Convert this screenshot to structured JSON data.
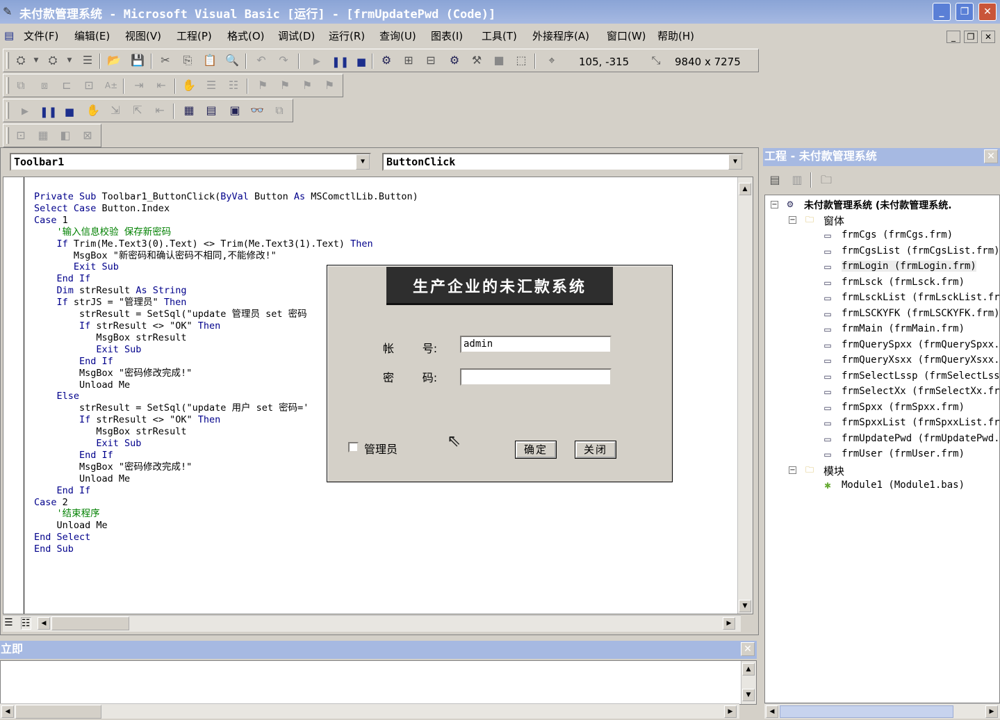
{
  "window": {
    "title": "未付款管理系统 - Microsoft Visual Basic [运行] - [frmUpdatePwd (Code)]",
    "min_label": "_",
    "restore_label": "❐",
    "close_label": "✕"
  },
  "menu": [
    "文件(F)",
    "编辑(E)",
    "视图(V)",
    "工程(P)",
    "格式(O)",
    "调试(D)",
    "运行(R)",
    "查询(U)",
    "图表(I)",
    "工具(T)",
    "外接程序(A)",
    "窗口(W)",
    "帮助(H)"
  ],
  "toolbar": {
    "position_readout": "105, -315",
    "size_readout": "9840 x 7275"
  },
  "code_window": {
    "object_combo": "Toolbar1",
    "procedure_combo": "ButtonClick"
  },
  "code_lines": [
    [
      {
        "t": "Private Sub ",
        "k": 1
      },
      {
        "t": "Toolbar1_ButtonClick("
      },
      {
        "t": "ByVal",
        "k": 1
      },
      {
        "t": " Button "
      },
      {
        "t": "As",
        "k": 1
      },
      {
        "t": " MSComctlLib.Button)"
      }
    ],
    [
      {
        "t": "Select Case",
        "k": 1
      },
      {
        "t": " Button.Index"
      }
    ],
    [
      {
        "t": "Case",
        "k": 1
      },
      {
        "t": " 1"
      }
    ],
    [
      {
        "t": "    '输入信息校验 保存新密码",
        "c": 1
      }
    ],
    [
      {
        "t": "    If",
        "k": 1
      },
      {
        "t": " Trim(Me.Text3(0).Text) <> Trim(Me.Text3(1).Text) "
      },
      {
        "t": "Then",
        "k": 1
      }
    ],
    [
      {
        "t": "       MsgBox \"新密码和确认密码不相同,不能修改!\""
      }
    ],
    [
      {
        "t": "       Exit Sub",
        "k": 1
      }
    ],
    [
      {
        "t": "    End If",
        "k": 1
      }
    ],
    [
      {
        "t": "    Dim",
        "k": 1
      },
      {
        "t": " strResult "
      },
      {
        "t": "As String",
        "k": 1
      }
    ],
    [
      {
        "t": "    If",
        "k": 1
      },
      {
        "t": " strJS = \"管理员\" "
      },
      {
        "t": "Then",
        "k": 1
      }
    ],
    [
      {
        "t": "        strResult = SetSql(\"update 管理员 set 密码"
      }
    ],
    [
      {
        "t": "        If",
        "k": 1
      },
      {
        "t": " strResult <> \"OK\" "
      },
      {
        "t": "Then",
        "k": 1
      }
    ],
    [
      {
        "t": "           MsgBox strResult"
      }
    ],
    [
      {
        "t": "           Exit Sub",
        "k": 1
      }
    ],
    [
      {
        "t": "        End If",
        "k": 1
      }
    ],
    [
      {
        "t": "        MsgBox \"密码修改完成!\""
      }
    ],
    [
      {
        "t": "        Unload Me"
      }
    ],
    [
      {
        "t": "    Else",
        "k": 1
      }
    ],
    [
      {
        "t": "        strResult = SetSql(\"update 用户 set 密码='"
      }
    ],
    [
      {
        "t": "        If",
        "k": 1
      },
      {
        "t": " strResult <> \"OK\" "
      },
      {
        "t": "Then",
        "k": 1
      }
    ],
    [
      {
        "t": "           MsgBox strResult"
      }
    ],
    [
      {
        "t": "           Exit Sub",
        "k": 1
      }
    ],
    [
      {
        "t": "        End If",
        "k": 1
      }
    ],
    [
      {
        "t": "        MsgBox \"密码修改完成!\""
      }
    ],
    [
      {
        "t": "        Unload Me"
      }
    ],
    [
      {
        "t": "    End If",
        "k": 1
      }
    ],
    [
      {
        "t": "Case",
        "k": 1
      },
      {
        "t": " 2"
      }
    ],
    [
      {
        "t": "    '结束程序",
        "c": 1
      }
    ],
    [
      {
        "t": "    Unload Me"
      }
    ],
    [
      {
        "t": "End Select",
        "k": 1
      }
    ],
    [
      {
        "t": "End Sub",
        "k": 1
      }
    ]
  ],
  "login_dialog": {
    "header": "生产企业的未汇款系统",
    "account_label": "帐        号:",
    "account_value": "admin",
    "password_label": "密        码:",
    "password_value": "",
    "admin_checkbox_label": "管理员",
    "admin_checked": false,
    "ok_button": "确定",
    "close_button": "关闭"
  },
  "project_explorer": {
    "title": "工程 - 未付款管理系统",
    "root": "未付款管理系统 (未付款管理系统.",
    "forms_folder": "窗体",
    "forms": [
      "frmCgs (frmCgs.frm)",
      "frmCgsList (frmCgsList.frm)",
      "frmLogin (frmLogin.frm)",
      "frmLsck (frmLsck.frm)",
      "frmLsckList (frmLsckList.fr",
      "frmLSCKYFK (frmLSCKYFK.frm)",
      "frmMain (frmMain.frm)",
      "frmQuerySpxx (frmQuerySpxx.",
      "frmQueryXsxx (frmQueryXsxx.",
      "frmSelectLssp (frmSelectLss",
      "frmSelectXx (frmSelectXx.fr",
      "frmSpxx (frmSpxx.frm)",
      "frmSpxxList (frmSpxxList.fr",
      "frmUpdatePwd (frmUpdatePwd.",
      "frmUser (frmUser.frm)"
    ],
    "modules_folder": "模块",
    "modules": [
      "Module1 (Module1.bas)"
    ]
  },
  "immediate": {
    "title": "立即",
    "content": ""
  }
}
